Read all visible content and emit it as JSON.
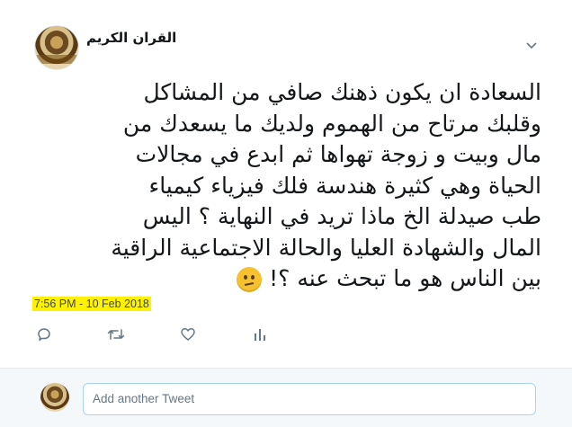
{
  "tweet": {
    "author_name": "القران الكريم",
    "text": "السعادة ان يكون ذهنك صافي من المشاكل\nوقلبك مرتاح من الهموم ولديك ما يسعدك من\nمال وبيت و زوجة تهواها ثم ابدع في مجالات\nالحياة وهي كثيرة هندسة فلك فيزياء كيمياء\nطب صيدلة الخ ماذا تريد في النهاية ؟ اليس\nالمال والشهادة العليا والحالة الاجتماعية الراقية\nبين الناس هو ما تبحث عنه ؟!",
    "emoji": "confused-face",
    "timestamp": "7:56 PM - 10 Feb 2018",
    "highlight_color": "#fff200"
  },
  "actions": [
    {
      "name": "reply",
      "icon": "reply-icon"
    },
    {
      "name": "retweet",
      "icon": "retweet-icon"
    },
    {
      "name": "like",
      "icon": "heart-icon"
    },
    {
      "name": "analytics",
      "icon": "analytics-icon"
    }
  ],
  "reply": {
    "placeholder": "Add another Tweet"
  },
  "colors": {
    "text": "#14171a",
    "muted": "#657786",
    "reply_bg": "#f5f8fa",
    "input_border": "#a9d3f2"
  }
}
